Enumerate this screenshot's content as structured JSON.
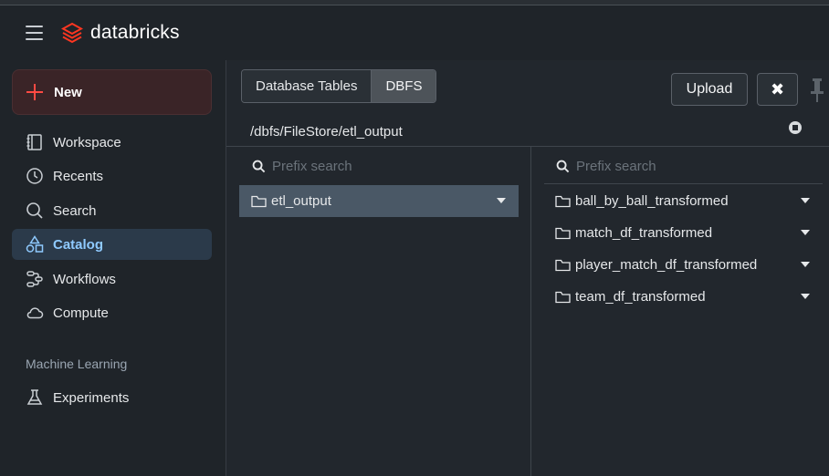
{
  "header": {
    "brand": "databricks"
  },
  "sidebar": {
    "new_label": "New",
    "items": [
      {
        "label": "Workspace",
        "icon": "workspace-icon"
      },
      {
        "label": "Recents",
        "icon": "clock-icon"
      },
      {
        "label": "Search",
        "icon": "search-icon"
      },
      {
        "label": "Catalog",
        "icon": "catalog-icon",
        "active": true
      },
      {
        "label": "Workflows",
        "icon": "workflows-icon"
      },
      {
        "label": "Compute",
        "icon": "cloud-icon"
      }
    ],
    "section_ml": "Machine Learning",
    "ml_items": [
      {
        "label": "Experiments",
        "icon": "flask-icon"
      }
    ]
  },
  "main": {
    "tabs": [
      {
        "label": "Database Tables",
        "selected": false
      },
      {
        "label": "DBFS",
        "selected": true
      }
    ],
    "upload_label": "Upload",
    "close_glyph": "✖",
    "path": "/dbfs/FileStore/etl_output",
    "left_pane": {
      "search_placeholder": "Prefix search",
      "items": [
        "etl_output"
      ]
    },
    "right_pane": {
      "search_placeholder": "Prefix search",
      "items": [
        "ball_by_ball_transformed",
        "match_df_transformed",
        "player_match_df_transformed",
        "team_df_transformed"
      ]
    }
  },
  "colors": {
    "background": "#1f2429",
    "accent_red": "#ff4a43",
    "active_text": "#8fcaff",
    "selected_row": "#4a5866"
  }
}
